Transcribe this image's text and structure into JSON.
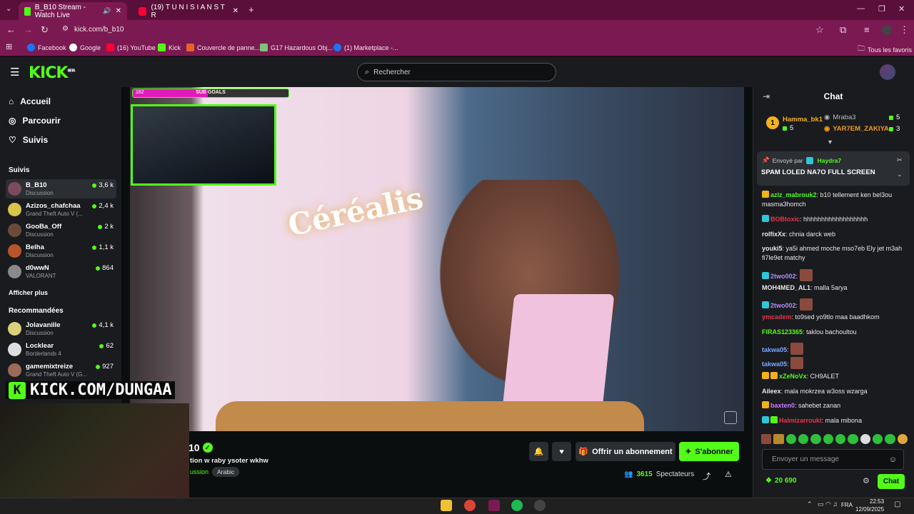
{
  "browser": {
    "tabs": [
      {
        "label": "B_B10 Stream - Watch Live",
        "active": true
      },
      {
        "label": "(19) T U N I S I A N S T R",
        "active": false
      }
    ],
    "url": "kick.com/b_b10",
    "bookmarks": [
      "Facebook",
      "Google",
      "(16) YouTube",
      "Kick",
      "Couvercle de panne...",
      "G17 Hazardous Obj...",
      "(1) Marketplace -..."
    ],
    "all_bookmarks": "Tous les favoris"
  },
  "header": {
    "logo": "KICK",
    "logo_sup": "BETA",
    "search_placeholder": "Rechercher"
  },
  "sidebar": {
    "nav": [
      {
        "label": "Accueil",
        "icon": "home-icon"
      },
      {
        "label": "Parcourir",
        "icon": "compass-icon"
      },
      {
        "label": "Suivis",
        "icon": "heart-icon"
      }
    ],
    "followed_title": "Suivis",
    "followed": [
      {
        "name": "B_B10",
        "category": "Discussion",
        "viewers": "3,6 k",
        "selected": true
      },
      {
        "name": "Azizos_chafchaa",
        "category": "Grand Theft Auto V (...",
        "viewers": "2,4 k"
      },
      {
        "name": "GooBa_Off",
        "category": "Discussion",
        "viewers": "2 k"
      },
      {
        "name": "Belha",
        "category": "Discussion",
        "viewers": "1,1 k"
      },
      {
        "name": "d0wwN",
        "category": "VALORANT",
        "viewers": "864"
      }
    ],
    "show_more": "Afficher plus",
    "recommended_title": "Recommandées",
    "recommended": [
      {
        "name": "Jolavanille",
        "category": "Discussion",
        "viewers": "4,1 k"
      },
      {
        "name": "Locklear",
        "category": "Borderlands 4",
        "viewers": "62"
      },
      {
        "name": "gamemixtreize",
        "category": "Grand Theft Auto V (G...",
        "viewers": "927"
      }
    ]
  },
  "video": {
    "sub_goals_label": "SUB GOALS",
    "sub_goals_count": "162",
    "sub_goals_progress": 0.48,
    "overlay_banner": "KICK.COM/DUNGAA"
  },
  "stream": {
    "streamer": "B_B10",
    "streamer_visible": "10",
    "title": "tion w  raby ysoter wkhw",
    "category": "ussion",
    "language": "Arabic",
    "gift_label": "Offrir un abonnement",
    "subscribe_label": "S'abonner",
    "viewers_count": "3615",
    "viewers_label": "Spectateurs"
  },
  "chat": {
    "title": "Chat",
    "leaderboard": [
      {
        "rank": "1",
        "name": "Hamma_bk1",
        "count": "5"
      },
      {
        "name": "Mraba3",
        "count": "5"
      },
      {
        "name": "YAR7EM_ZAKIYA",
        "count": "3"
      }
    ],
    "pinned": {
      "sent_by_label": "Envoyé par",
      "sender": "Haydra7",
      "message": "SPAM LOLED NA7O FULL SCREEN"
    },
    "messages": [
      {
        "user": "aziz_mabrouk2",
        "color": "#53fc18",
        "text": "b10 tellement ken bel3ou masma3homch"
      },
      {
        "user": "BOBtoxic",
        "color": "#e8364a",
        "text": "hhhhhhhhhhhhhhhhhh"
      },
      {
        "user": "rolfixXx",
        "color": "#ffffff",
        "text": "chnia darck web"
      },
      {
        "user": "youki5",
        "color": "#ffffff",
        "text": "ya5i ahmed moche mso7eb Ely jet m3ah fi7le9et matchy"
      },
      {
        "user": "2two002",
        "color": "#b08cff",
        "text": ""
      },
      {
        "user": "MOH4MED_AL1",
        "color": "#ffffff",
        "text": "malla 5arya"
      },
      {
        "user": "2two002",
        "color": "#b08cff",
        "text": ""
      },
      {
        "user": "ymcadem",
        "color": "#e8364a",
        "text": "to9sed yo9tlo maa baadhkom"
      },
      {
        "user": "FIRAS123365",
        "color": "#53fc18",
        "text": "taklou bachoultou"
      },
      {
        "user": "takwa05",
        "color": "#7aa8ff",
        "text": ""
      },
      {
        "user": "takwa05",
        "color": "#7aa8ff",
        "text": ""
      },
      {
        "user": "xZeNoVx",
        "color": "#53fc18",
        "text": "CH9ALET"
      },
      {
        "user": "Aileex",
        "color": "#ffffff",
        "text": "mala mokrzea w3oss wzarga"
      },
      {
        "user": "baxten0",
        "color": "#c77dff",
        "text": "sahebet zanan"
      },
      {
        "user": "Halmizarrouki",
        "color": "#e8364a",
        "text": "mala mibona"
      }
    ],
    "input_placeholder": "Envoyer un message",
    "points": "20 690",
    "send_label": "Chat"
  },
  "taskbar": {
    "language": "FRA",
    "time": "22:53",
    "date": "12/09/2025"
  }
}
